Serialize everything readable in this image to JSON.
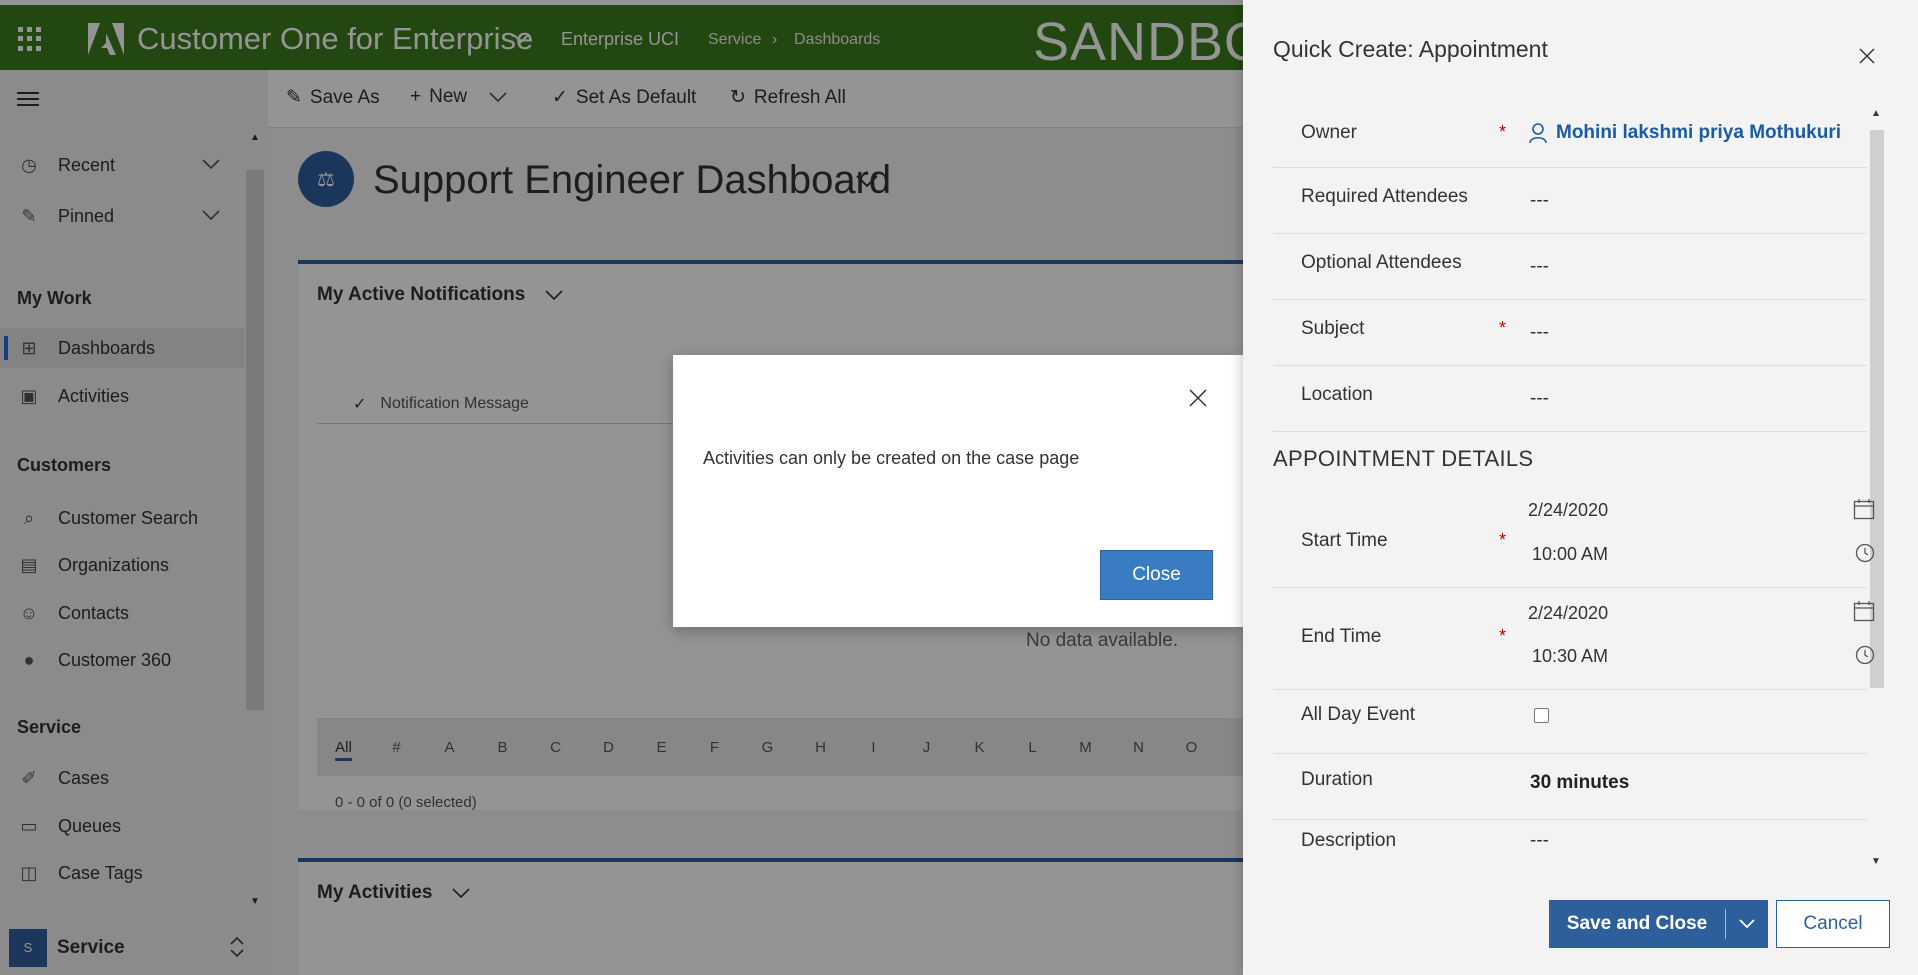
{
  "topbar": {
    "app_title": "Customer One for Enterprise",
    "environment": "Enterprise UCI",
    "breadcrumb": [
      "Service",
      "Dashboards"
    ],
    "banner": "SANDBOX"
  },
  "sidebar": {
    "items_top": [
      {
        "label": "Recent",
        "icon": "clock-icon"
      },
      {
        "label": "Pinned",
        "icon": "pin-icon"
      }
    ],
    "groups": [
      {
        "title": "My Work",
        "items": [
          {
            "label": "Dashboards",
            "icon": "dashboard-icon",
            "active": true
          },
          {
            "label": "Activities",
            "icon": "clipboard-icon"
          }
        ]
      },
      {
        "title": "Customers",
        "items": [
          {
            "label": "Customer Search",
            "icon": "search-record-icon"
          },
          {
            "label": "Organizations",
            "icon": "building-icon"
          },
          {
            "label": "Contacts",
            "icon": "person-icon"
          },
          {
            "label": "Customer 360",
            "icon": "person-filled-icon"
          }
        ]
      },
      {
        "title": "Service",
        "items": [
          {
            "label": "Cases",
            "icon": "wrench-icon"
          },
          {
            "label": "Queues",
            "icon": "queue-icon"
          },
          {
            "label": "Case Tags",
            "icon": "tag-icon"
          }
        ]
      }
    ],
    "area": {
      "badge": "S",
      "label": "Service"
    }
  },
  "commands": {
    "save_as": "Save As",
    "new": "New",
    "set_default": "Set As Default",
    "refresh_all": "Refresh All"
  },
  "dashboard": {
    "title": "Support Engineer Dashboard",
    "panel1": {
      "title": "My Active Notifications",
      "column": "Notification Message",
      "empty": "No data available.",
      "alphabet": [
        "All",
        "#",
        "A",
        "B",
        "C",
        "D",
        "E",
        "F",
        "G",
        "H",
        "I",
        "J",
        "K",
        "L",
        "M",
        "N",
        "O"
      ],
      "paging": "0 - 0 of 0 (0 selected)"
    },
    "panel2": {
      "title": "My Activities"
    }
  },
  "dialog": {
    "message": "Activities can only be created on the case page",
    "button": "Close"
  },
  "quick_create": {
    "title": "Quick Create: Appointment",
    "owner_label": "Owner",
    "owner_value": "Mohini lakshmi priya Mothukuri",
    "required_attendees_label": "Required Attendees",
    "required_attendees_value": "---",
    "optional_attendees_label": "Optional Attendees",
    "optional_attendees_value": "---",
    "subject_label": "Subject",
    "subject_value": "---",
    "location_label": "Location",
    "location_value": "---",
    "section_title": "APPOINTMENT DETAILS",
    "start_time_label": "Start Time",
    "start_date": "2/24/2020",
    "start_time": "10:00 AM",
    "end_time_label": "End Time",
    "end_date": "2/24/2020",
    "end_time": "10:30 AM",
    "all_day_label": "All Day Event",
    "all_day_checked": false,
    "duration_label": "Duration",
    "duration_value": "30 minutes",
    "description_label": "Description",
    "description_value": "---",
    "required_marker": "*",
    "save_close": "Save and Close",
    "cancel": "Cancel"
  },
  "colors": {
    "topbar": "#3c7a1d",
    "primary": "#2e5f9d",
    "dialog_button": "#3a7cc3",
    "required": "#cc0000"
  }
}
